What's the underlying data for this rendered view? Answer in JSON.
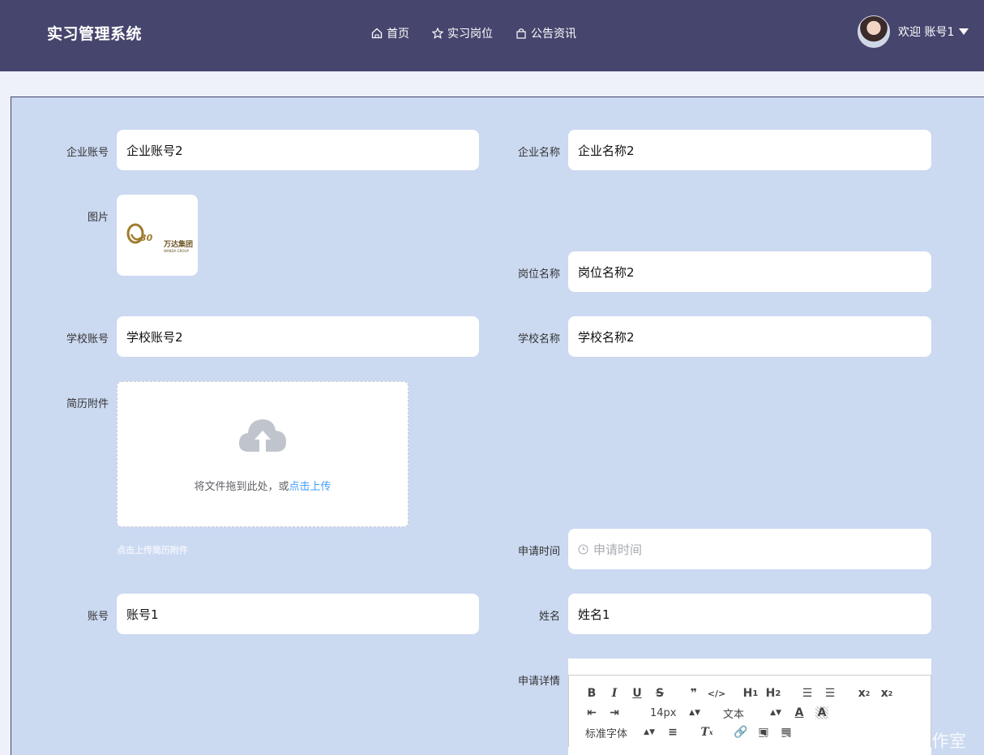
{
  "header": {
    "brand": "实习管理系统",
    "nav": [
      {
        "label": "首页",
        "icon": "home-icon"
      },
      {
        "label": "实习岗位",
        "icon": "star-icon"
      },
      {
        "label": "公告资讯",
        "icon": "bag-icon"
      }
    ],
    "welcome": "欢迎 账号1"
  },
  "form": {
    "company_account": {
      "label": "企业账号",
      "value": "企业账号2"
    },
    "company_name": {
      "label": "企业名称",
      "value": "企业名称2"
    },
    "image": {
      "label": "图片",
      "logo_text": "万达集团",
      "logo_sub": "WANDA GROUP"
    },
    "position_name": {
      "label": "岗位名称",
      "value": "岗位名称2"
    },
    "school_account": {
      "label": "学校账号",
      "value": "学校账号2"
    },
    "school_name": {
      "label": "学校名称",
      "value": "学校名称2"
    },
    "resume": {
      "label": "简历附件",
      "drop_text": "将文件拖到此处，或",
      "click_text": "点击上传",
      "tip": "点击上传简历附件"
    },
    "apply_time": {
      "label": "申请时间",
      "placeholder": "申请时间"
    },
    "account": {
      "label": "账号",
      "value": "账号1"
    },
    "name": {
      "label": "姓名",
      "value": "姓名1"
    },
    "details": {
      "label": "申请详情"
    }
  },
  "editor": {
    "font_size": "14px",
    "header_select": "文本",
    "font_family": "标准字体"
  },
  "watermark": "CSDN @计算机毕设工作室"
}
